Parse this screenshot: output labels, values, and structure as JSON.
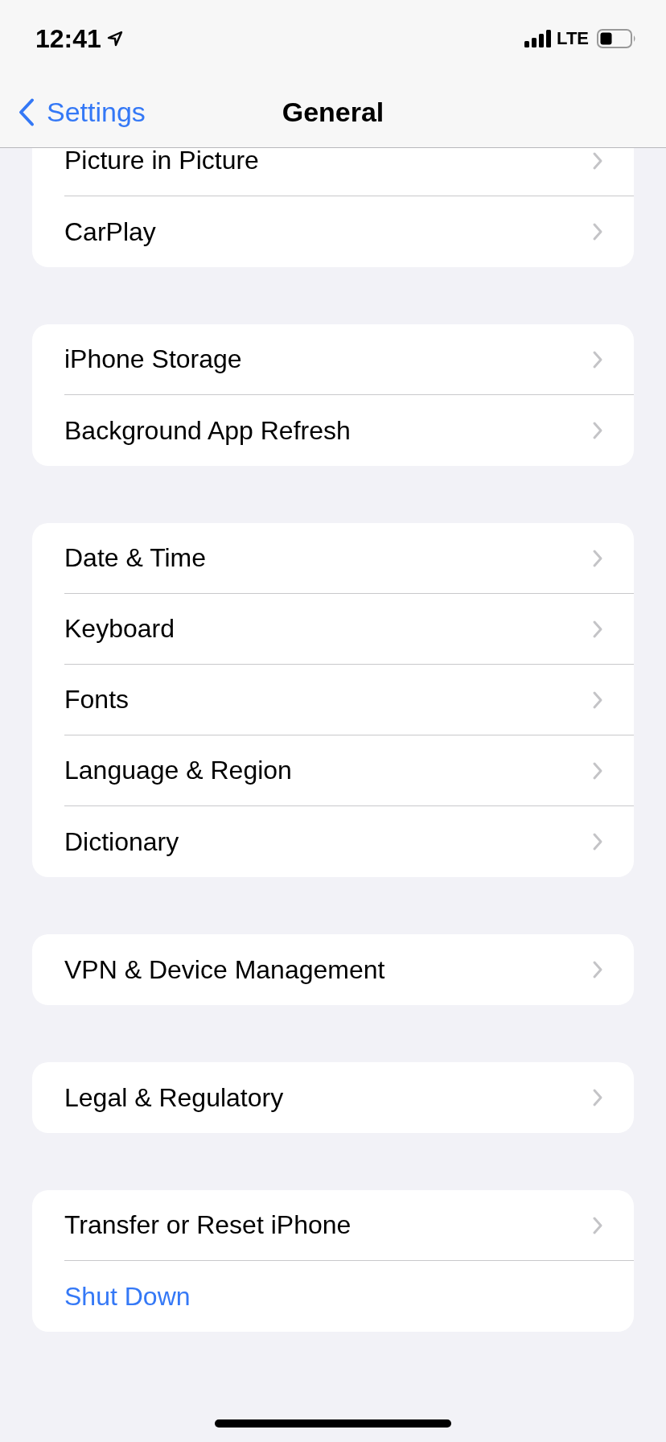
{
  "status_bar": {
    "time": "12:41",
    "network": "LTE"
  },
  "nav_bar": {
    "back_label": "Settings",
    "title": "General"
  },
  "sections": [
    {
      "rows": [
        {
          "label": "Picture in Picture",
          "kind": "link"
        },
        {
          "label": "CarPlay",
          "kind": "link"
        }
      ]
    },
    {
      "rows": [
        {
          "label": "iPhone Storage",
          "kind": "link"
        },
        {
          "label": "Background App Refresh",
          "kind": "link"
        }
      ]
    },
    {
      "rows": [
        {
          "label": "Date & Time",
          "kind": "link"
        },
        {
          "label": "Keyboard",
          "kind": "link"
        },
        {
          "label": "Fonts",
          "kind": "link"
        },
        {
          "label": "Language & Region",
          "kind": "link"
        },
        {
          "label": "Dictionary",
          "kind": "link"
        }
      ]
    },
    {
      "rows": [
        {
          "label": "VPN & Device Management",
          "kind": "link"
        }
      ]
    },
    {
      "rows": [
        {
          "label": "Legal & Regulatory",
          "kind": "link"
        }
      ]
    },
    {
      "rows": [
        {
          "label": "Transfer or Reset iPhone",
          "kind": "link"
        },
        {
          "label": "Shut Down",
          "kind": "action"
        }
      ]
    }
  ]
}
